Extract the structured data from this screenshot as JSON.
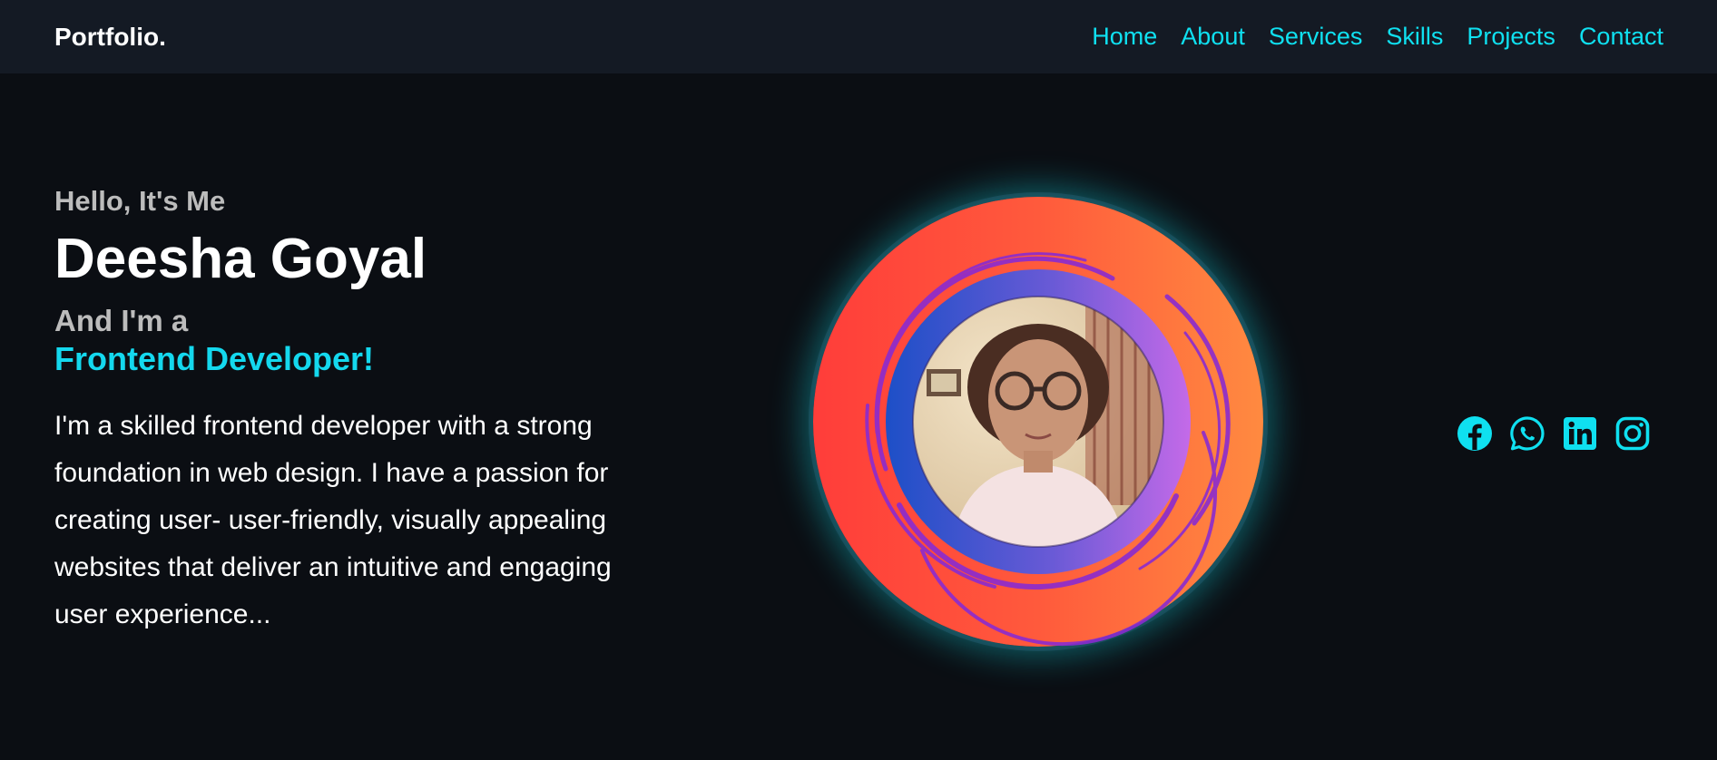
{
  "nav": {
    "logo": "Portfolio.",
    "links": [
      "Home",
      "About",
      "Services",
      "Skills",
      "Projects",
      "Contact"
    ]
  },
  "hero": {
    "greeting": "Hello, It's Me",
    "name": "Deesha Goyal",
    "and_im": "And I'm a",
    "role": "Frontend Developer!",
    "bio": "I'm a skilled frontend developer with a strong foundation in web design. I have a passion for creating user- user-friendly, visually appealing websites that deliver an intuitive and engaging user experience..."
  },
  "socials": [
    "facebook-icon",
    "whatsapp-icon",
    "linkedin-icon",
    "instagram-icon"
  ],
  "colors": {
    "accent": "#0fe0f0",
    "background": "#0b0e13",
    "navbar": "#141a24",
    "ring_orange": "#ff6b3d",
    "ring_purple": "#8a3ad8"
  }
}
